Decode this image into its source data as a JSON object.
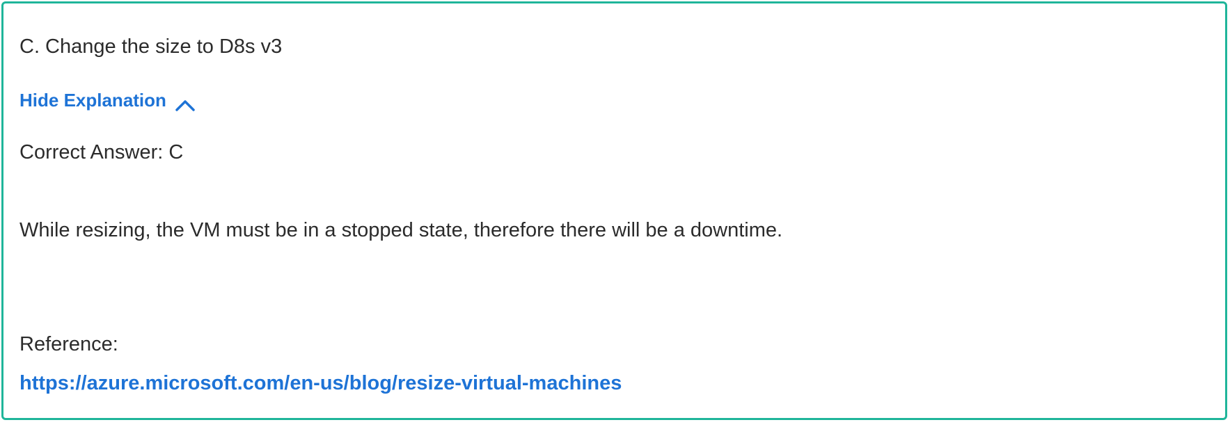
{
  "answer_card": {
    "option_text": "C. Change the size to D8s v3",
    "toggle_label": "Hide Explanation",
    "toggle_icon": "chevron-up-icon",
    "correct_answer_text": "Correct Answer: C",
    "explanation_text": "While resizing, the VM must be in a stopped state, therefore there will be a downtime.",
    "reference_label": "Reference:",
    "reference_url": "https://azure.microsoft.com/en-us/blog/resize-virtual-machines"
  },
  "colors": {
    "border": "#1fb59a",
    "link": "#1e73d6",
    "text": "#2b2b2b"
  }
}
